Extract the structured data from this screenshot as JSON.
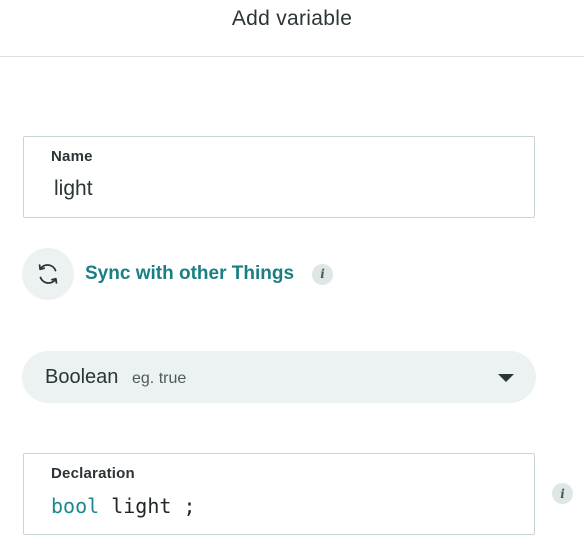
{
  "header": {
    "title": "Add variable"
  },
  "name_field": {
    "label": "Name",
    "value": "light"
  },
  "sync": {
    "icon": "sync-arrows-icon",
    "label": "Sync with other Things",
    "info_icon": "info-icon"
  },
  "type_select": {
    "selected": "Boolean",
    "example": "eg. true",
    "icon": "chevron-down-icon"
  },
  "declaration": {
    "label": "Declaration",
    "keyword": "bool",
    "identifier": "light",
    "terminator": ";",
    "info_icon": "info-icon"
  },
  "colors": {
    "accent": "#1a7f85",
    "keyword": "#1b8a8f",
    "pill_background": "#ecf1f1",
    "border": "#c9d4d5",
    "text": "#2b3436"
  }
}
